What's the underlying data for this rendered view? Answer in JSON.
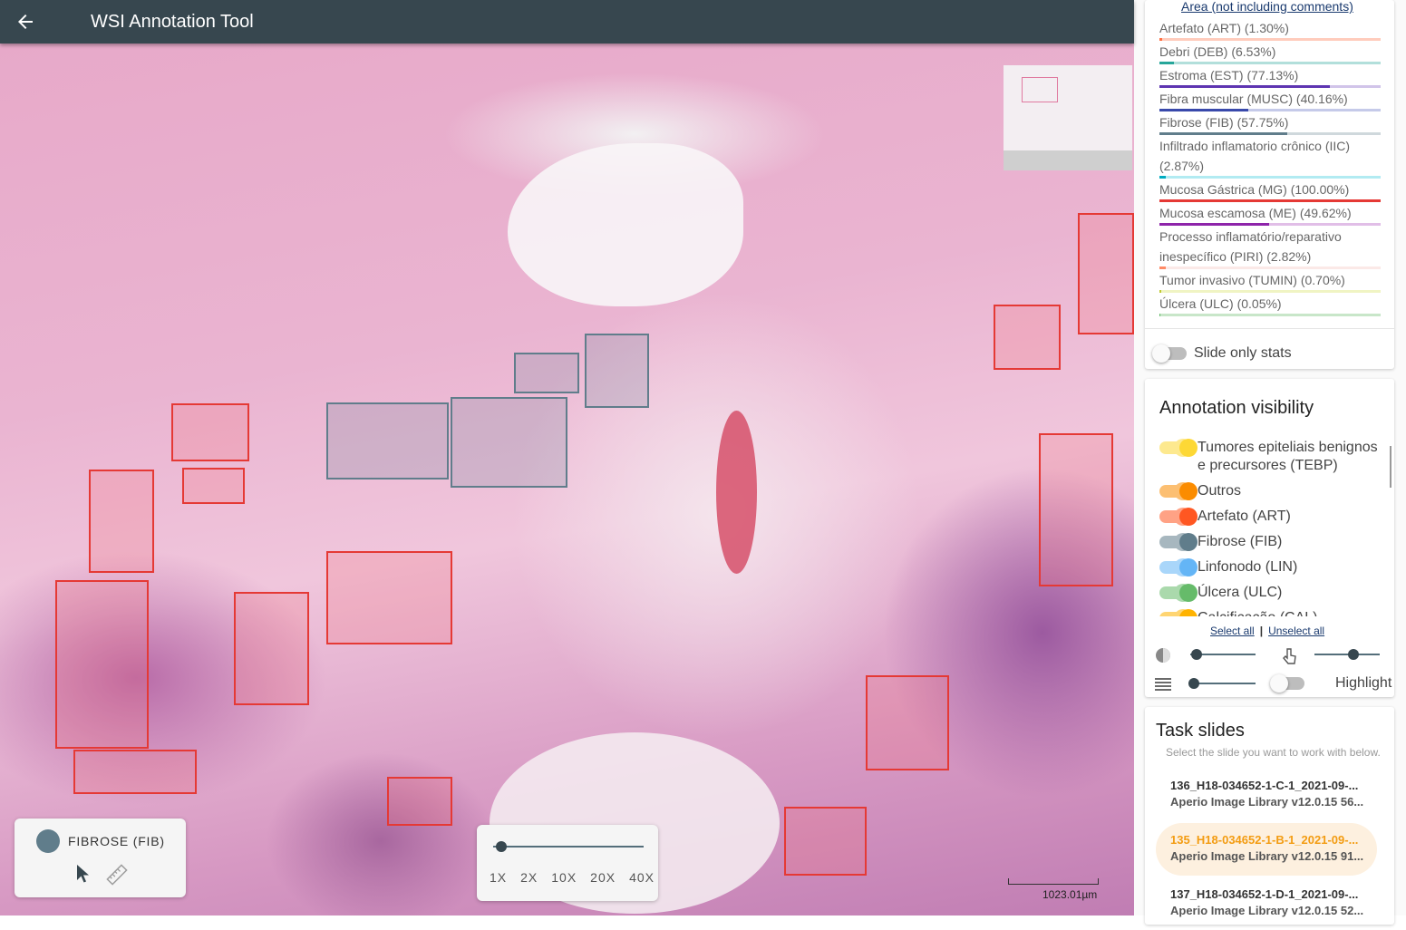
{
  "appbar": {
    "back_icon": "arrow-left-icon",
    "title": "WSI Annotation Tool"
  },
  "viewer": {
    "active_tool": {
      "label": "FIBROSE (FIB)",
      "color": "#607d8b",
      "tools": [
        "pointer-icon",
        "ruler-icon"
      ]
    },
    "zoom": {
      "levels": [
        "1X",
        "2X",
        "10X",
        "20X",
        "40X"
      ]
    },
    "scale": "1023.01µm",
    "annotation_colors": {
      "red": "#e53935",
      "fibrose": "#607d8b"
    }
  },
  "stats": {
    "heading": "Area (not including comments)",
    "items": [
      {
        "label": "Artefato (ART) (1.30%)",
        "pct": 1.3,
        "color": "#ff7043",
        "track": "#ffccbc"
      },
      {
        "label": "Debri (DEB) (6.53%)",
        "pct": 6.53,
        "color": "#26a69a",
        "track": "#b2dfdb"
      },
      {
        "label": "Estroma (EST) (77.13%)",
        "pct": 77.13,
        "color": "#5e35b1",
        "track": "#d1c4e9"
      },
      {
        "label": "Fibra muscular (MUSC) (40.16%)",
        "pct": 40.16,
        "color": "#3949ab",
        "track": "#c5cae9"
      },
      {
        "label": "Fibrose (FIB) (57.75%)",
        "pct": 57.75,
        "color": "#607d8b",
        "track": "#cfd8dc"
      },
      {
        "label": "Infiltrado inflamatorio crônico (IIC) (2.87%)",
        "pct": 2.87,
        "color": "#00acc1",
        "track": "#b2ebf2"
      },
      {
        "label": "Mucosa Gástrica (MG) (100.00%)",
        "pct": 100.0,
        "color": "#e53935",
        "track": "#ffcdd2"
      },
      {
        "label": "Mucosa escamosa (ME) (49.62%)",
        "pct": 49.62,
        "color": "#8e24aa",
        "track": "#e1bee7"
      },
      {
        "label": "Processo inflamatório/reparativo inespecífico (PIRI) (2.82%)",
        "pct": 2.82,
        "color": "#ff8a65",
        "track": "#fbe9e7"
      },
      {
        "label": "Tumor invasivo (TUMIN) (0.70%)",
        "pct": 0.7,
        "color": "#c0ca33",
        "track": "#f0f4c3"
      },
      {
        "label": "Úlcera (ULC) (0.05%)",
        "pct": 0.05,
        "color": "#66bb6a",
        "track": "#c8e6c9"
      }
    ],
    "slide_only_label": "Slide only stats"
  },
  "visibility": {
    "title": "Annotation visibility",
    "items": [
      {
        "label": "Tumores epiteliais benignos e precursores (TEBP)",
        "color": "#fdd835"
      },
      {
        "label": "Outros",
        "color": "#fb8c00"
      },
      {
        "label": "Artefato (ART)",
        "color": "#ff5722"
      },
      {
        "label": "Fibrose (FIB)",
        "color": "#607d8b"
      },
      {
        "label": "Linfonodo (LIN)",
        "color": "#64b5f6"
      },
      {
        "label": "Úlcera (ULC)",
        "color": "#66bb6a"
      },
      {
        "label": "Calcificação (CAL)",
        "color": "#ffb300"
      }
    ],
    "select_all": "Select all",
    "unselect_all": "Unselect all",
    "opacity_value": 0.1,
    "brightness_value": 0.6,
    "stroke_value": 0.05,
    "highlight_label": "Highlight"
  },
  "tasks": {
    "title": "Task slides",
    "subtitle": "Select the slide you want to work with below.",
    "slides": [
      {
        "name": "136_H18-034652-1-C-1_2021-09-...",
        "desc": "Aperio Image Library v12.0.15  56...",
        "active": false
      },
      {
        "name": "135_H18-034652-1-B-1_2021-09-...",
        "desc": "Aperio Image Library v12.0.15  91...",
        "active": true
      },
      {
        "name": "137_H18-034652-1-D-1_2021-09-...",
        "desc": "Aperio Image Library v12.0.15  52...",
        "active": false
      }
    ]
  }
}
